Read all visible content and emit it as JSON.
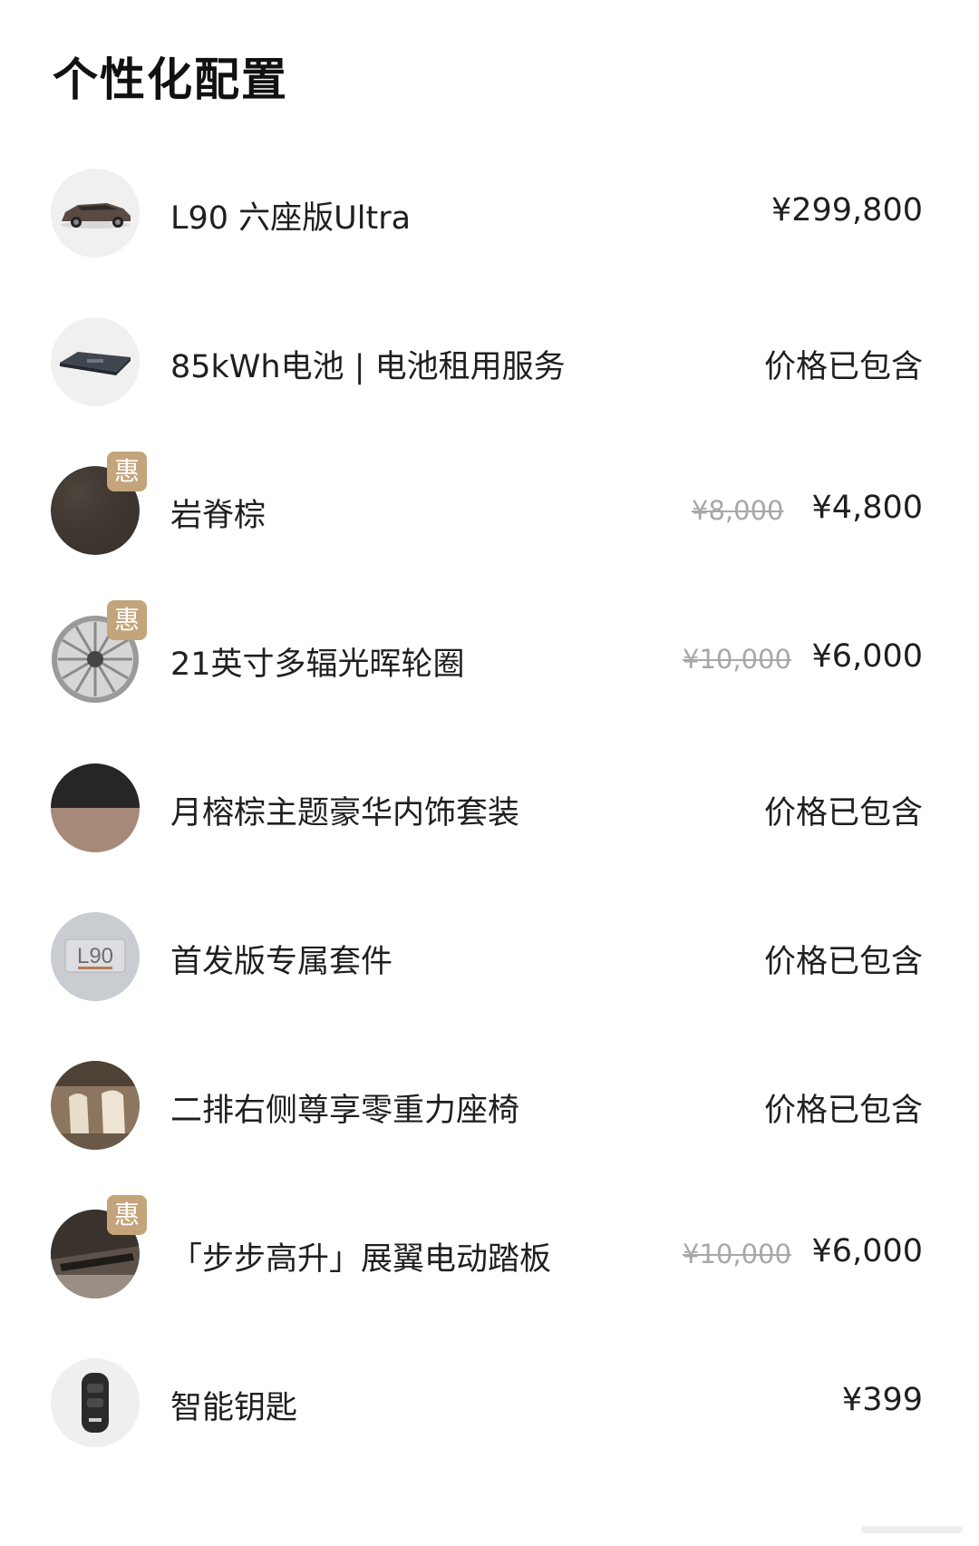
{
  "page": {
    "title": "个性化配置"
  },
  "items": [
    {
      "name": "L90 六座版Ultra",
      "price": "¥299,800",
      "icon": "car-icon"
    },
    {
      "name": "85kWh电池 | 电池租用服务",
      "price": "价格已包含",
      "icon": "battery-icon"
    },
    {
      "name": "岩脊棕",
      "original_price": "¥8,000",
      "price": "¥4,800",
      "badge": "惠",
      "icon": "color-swatch-icon"
    },
    {
      "name": "21英寸多辐光晖轮圈",
      "original_price": "¥10,000",
      "price": "¥6,000",
      "badge": "惠",
      "icon": "wheel-icon"
    },
    {
      "name": "月榕棕主题豪华内饰套装",
      "price": "价格已包含",
      "icon": "interior-swatch-icon"
    },
    {
      "name": "首发版专属套件",
      "price": "价格已包含",
      "icon": "badge-emblem-icon"
    },
    {
      "name": "二排右侧尊享零重力座椅",
      "price": "价格已包含",
      "icon": "seat-icon"
    },
    {
      "name": "「步步高升」展翼电动踏板",
      "original_price": "¥10,000",
      "price": "¥6,000",
      "badge": "惠",
      "icon": "step-board-icon"
    },
    {
      "name": "智能钥匙",
      "price": "¥399",
      "icon": "key-icon"
    }
  ],
  "colors": {
    "badge": "#c4a47a",
    "strikethrough": "#a8a8a8",
    "text": "#1f1f1f"
  }
}
